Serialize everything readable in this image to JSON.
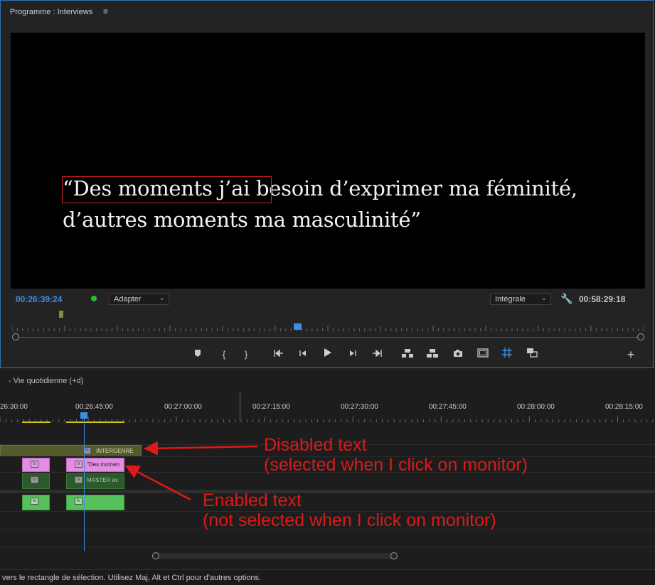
{
  "monitor": {
    "title": "Programme : Interviews",
    "menu_icon": "hamburger-icon",
    "subtitle_line1": "“Des moments j’ai besoin d’exprimer ma féminité,",
    "subtitle_line2": "d’autres moments ma masculinité”",
    "timecode_current": "00:26:39:24",
    "zoom_select": "Adapter",
    "resolution_select": "Intégrale",
    "timecode_duration": "00:58:29:18",
    "transport_icons": [
      "marker-icon",
      "mark-in-icon",
      "mark-out-icon",
      "go-to-in-icon",
      "step-back-icon",
      "play-icon",
      "step-forward-icon",
      "go-to-out-icon",
      "lift-icon",
      "extract-icon",
      "export-frame-icon",
      "safe-margins-icon",
      "comparison-view-icon",
      "proxy-toggle-icon",
      "add-button-icon"
    ]
  },
  "timeline": {
    "sequence_name": "- Vie quotidienne (+d)",
    "ruler_labels": [
      "26:30:00",
      "00:26:45:00",
      "00:27:00:00",
      "00:27:15:00",
      "00:27:30:00",
      "00:27:45:00",
      "00:28:00:00",
      "00:28:15:00"
    ],
    "clips": {
      "intergenre_label": "INTERGENRE",
      "text_clip_label": "\"Des momen",
      "master_clip_label": "MASTER av",
      "fx_label": "fx"
    }
  },
  "annotations": {
    "disabled_line1": "Disabled text",
    "disabled_line2": "(selected when I click on monitor)",
    "enabled_line1": "Enabled text",
    "enabled_line2": "(not selected when I click on monitor)"
  },
  "status_bar": {
    "text": "vers le rectangle de sélection. Utilisez Maj, Alt et Ctrl pour d'autres options."
  },
  "colors": {
    "accent_blue": "#3b8fe3",
    "annotation_red": "#e01818",
    "text_clip_pink": "#e58de5",
    "audio_clip_green": "#56c15a",
    "video_clip_dark_green": "#2d5a2d",
    "disabled_clip_olive": "#555a2a"
  }
}
